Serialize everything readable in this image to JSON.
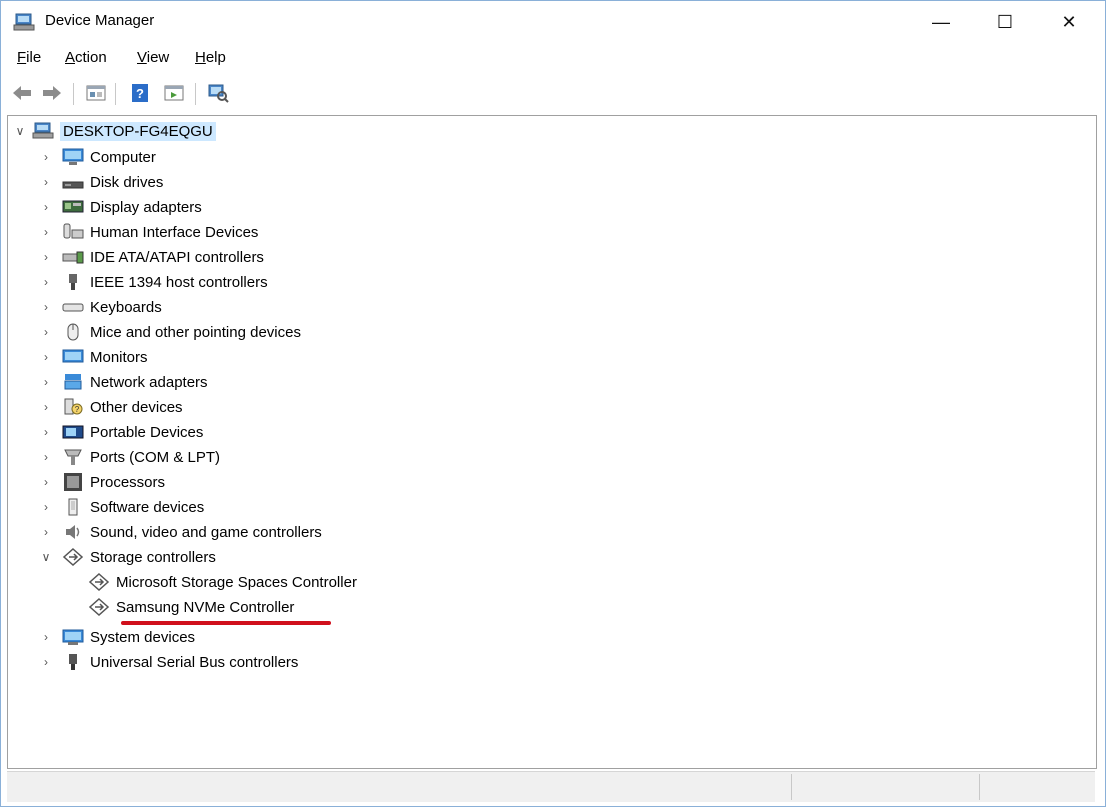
{
  "window": {
    "title": "Device Manager"
  },
  "titlebar": {
    "minimize": "—",
    "maximize": "☐",
    "close": "✕"
  },
  "menu": [
    {
      "label": "File",
      "accel": "F",
      "rest": "ile"
    },
    {
      "label": "Action",
      "accel": "A",
      "rest": "ction"
    },
    {
      "label": "View",
      "accel": "V",
      "rest": "iew"
    },
    {
      "label": "Help",
      "accel": "H",
      "rest": "elp"
    }
  ],
  "toolbar": {
    "buttons": [
      "back-icon",
      "forward-icon",
      "properties-icon",
      "help-icon",
      "update-icon",
      "scan-hardware-icon"
    ]
  },
  "tree": {
    "root": "DESKTOP-FG4EQGU",
    "categories": [
      "Computer",
      "Disk drives",
      "Display adapters",
      "Human Interface Devices",
      "IDE ATA/ATAPI controllers",
      "IEEE 1394 host controllers",
      "Keyboards",
      "Mice and other pointing devices",
      "Monitors",
      "Network adapters",
      "Other devices",
      "Portable Devices",
      "Ports (COM & LPT)",
      "Processors",
      "Software devices",
      "Sound, video and game controllers",
      "Storage controllers",
      "System devices",
      "Universal Serial Bus controllers"
    ],
    "storage_children": [
      "Microsoft Storage Spaces Controller",
      "Samsung NVMe Controller"
    ],
    "expanded_category": "Storage controllers",
    "highlighted_item": "Samsung NVMe Controller",
    "highlight_color": "#d0101c"
  }
}
